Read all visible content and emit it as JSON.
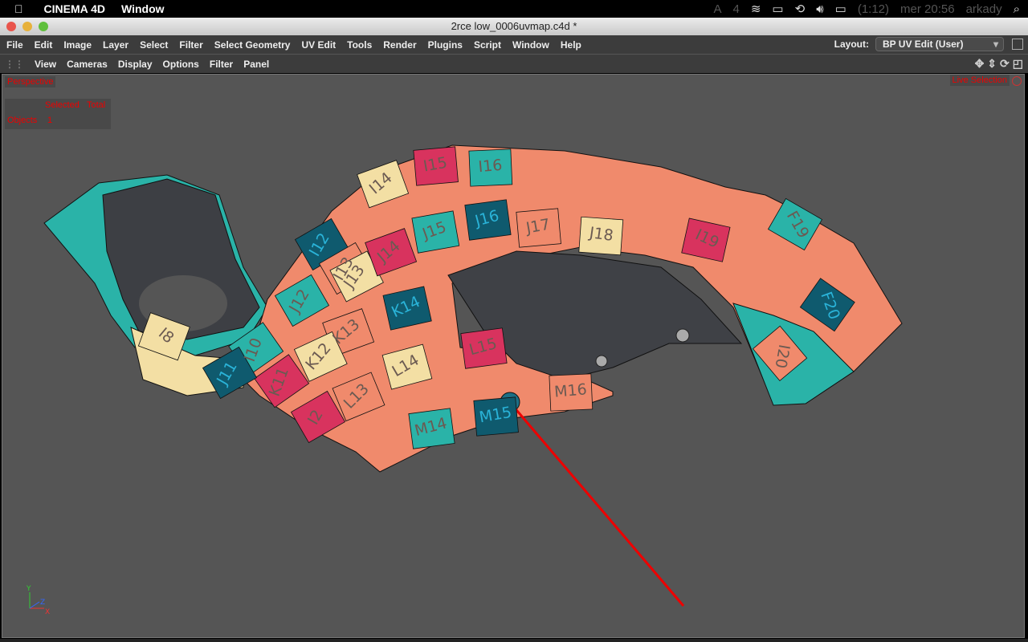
{
  "macmenu": {
    "app": "CINEMA 4D",
    "items": [
      "Window"
    ]
  },
  "status": {
    "adobe_count": "4",
    "battery": "(1:12)",
    "clock": "mer 20:56",
    "user": "arkady"
  },
  "window": {
    "title": "2rce low_0006uvmap.c4d *"
  },
  "menu": [
    "File",
    "Edit",
    "Image",
    "Layer",
    "Select",
    "Filter",
    "Select Geometry",
    "UV Edit",
    "Tools",
    "Render",
    "Plugins",
    "Script",
    "Window",
    "Help"
  ],
  "layout": {
    "label": "Layout:",
    "value": "BP UV Edit (User)"
  },
  "viewmenu": [
    "View",
    "Cameras",
    "Display",
    "Options",
    "Filter",
    "Panel"
  ],
  "viewport": {
    "camera": "Perspective",
    "tool": "Live Selection",
    "stats": {
      "col_selected": "Selected",
      "col_total": "Total",
      "row_label": "Objects",
      "selected": "1",
      "total": ""
    },
    "axes": {
      "y": "Y",
      "z": "Z",
      "x": "X"
    }
  },
  "uv_labels": [
    "J15",
    "J16",
    "J17",
    "J18",
    "I19",
    "F19",
    "F20",
    "I20",
    "I14",
    "I15",
    "I16",
    "I12",
    "I13",
    "J13",
    "J14",
    "J12",
    "K14",
    "K13",
    "K12",
    "K11",
    "I10",
    "J11",
    "L13",
    "L14",
    "L15",
    "M14",
    "M15",
    "M16",
    "I8",
    "I2"
  ],
  "colors": {
    "accent_red": "#e00000",
    "teal": "#2ab3a8",
    "dark_teal": "#0f5a6e",
    "salmon": "#f08a6c",
    "cream": "#f3dfa4",
    "crimson": "#d8335e"
  }
}
